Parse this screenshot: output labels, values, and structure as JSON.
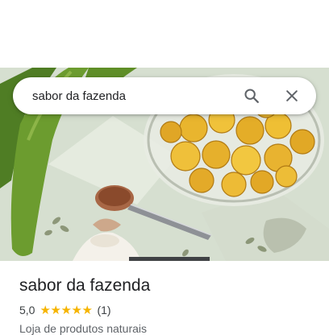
{
  "search": {
    "query": "sabor da fazenda"
  },
  "icons": {
    "search": "search-icon",
    "close": "close-icon"
  },
  "place": {
    "name": "sabor da fazenda",
    "rating": "5,0",
    "rating_stars": 5,
    "review_count": "(1)",
    "category": "Loja de produtos naturais"
  },
  "colors": {
    "star": "#f6b400",
    "text_primary": "#202124",
    "text_secondary": "#5f6368"
  }
}
